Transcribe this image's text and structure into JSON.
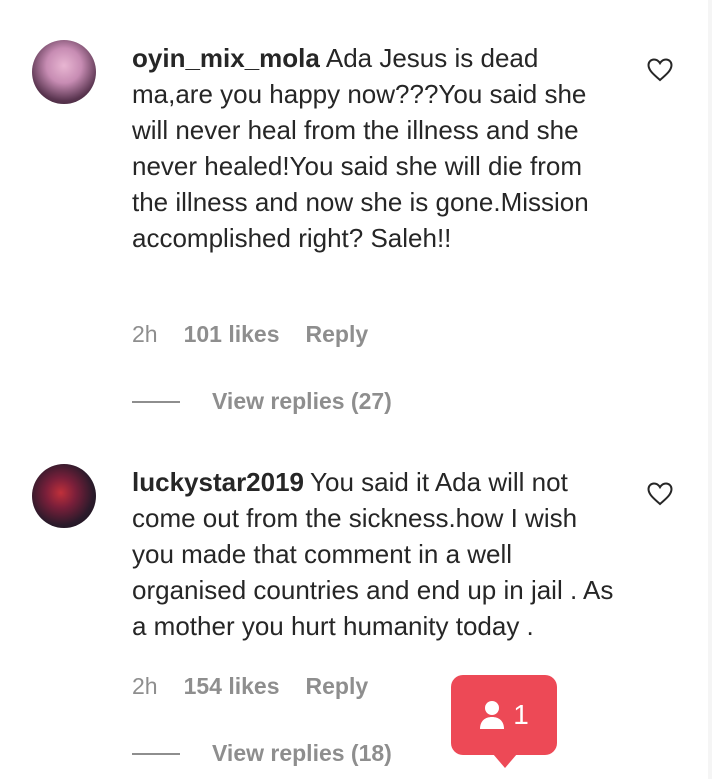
{
  "comments": [
    {
      "username": "oyin_mix_mola",
      "text": "Ada Jesus is dead ma,are you happy now???You said she will never heal from the illness and she never healed!You said she will die from the illness and now she is gone.Mission accomplished right? Saleh!!",
      "time": "2h",
      "likes": "101 likes",
      "reply": "Reply",
      "view_replies": "View replies (27)"
    },
    {
      "username": "luckystar2019",
      "text": "You said it Ada will not come out from the sickness.how I wish you made that comment in a well organised countries and end up in jail . As a mother you hurt humanity today .",
      "time": "2h",
      "likes": "154 likes",
      "reply": "Reply",
      "view_replies": "View replies (18)"
    }
  ],
  "notification": {
    "count": "1",
    "icon": "person-icon",
    "color": "#ed4956"
  }
}
